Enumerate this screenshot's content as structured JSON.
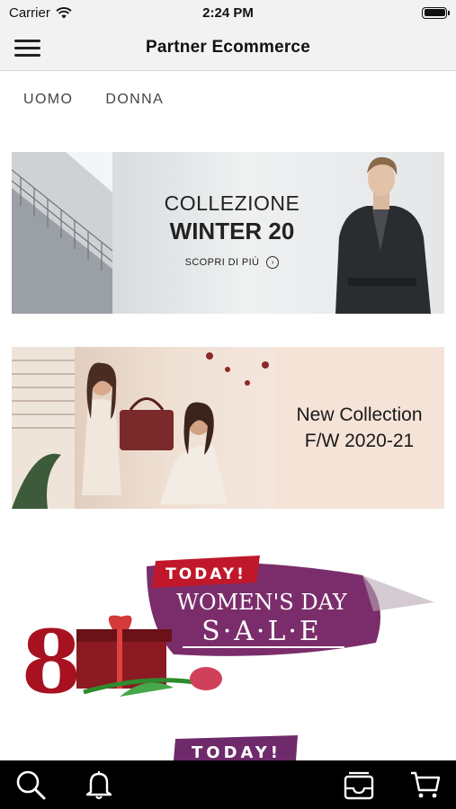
{
  "status_bar": {
    "carrier": "Carrier",
    "time": "2:24 PM",
    "battery_level": 1.0
  },
  "nav": {
    "title": "Partner Ecommerce",
    "menu_icon": "hamburger-menu-icon"
  },
  "categories": [
    {
      "label": "UOMO"
    },
    {
      "label": "DONNA"
    }
  ],
  "banners": [
    {
      "line1": "COLLEZIONE",
      "line2": "WINTER 20",
      "cta": "SCOPRI DI PIÙ"
    },
    {
      "line1": "New Collection",
      "line2": "F/W 2020-21"
    }
  ],
  "promo": {
    "badge": "TODAY!",
    "line1": "WOMEN'S DAY",
    "line2": "S·A·L·E",
    "number": "8",
    "badge_bottom": "TODAY!"
  },
  "tab_bar": {
    "items": [
      {
        "name": "search",
        "icon": "search-icon"
      },
      {
        "name": "notifications",
        "icon": "bell-icon"
      },
      {
        "name": "orders",
        "icon": "inbox-tray-icon"
      },
      {
        "name": "cart",
        "icon": "cart-icon"
      }
    ]
  },
  "colors": {
    "chrome": "#f2f2f2",
    "tab_bar": "#000000",
    "promo_purple": "#7b2d6b",
    "promo_red": "#c0182a"
  }
}
